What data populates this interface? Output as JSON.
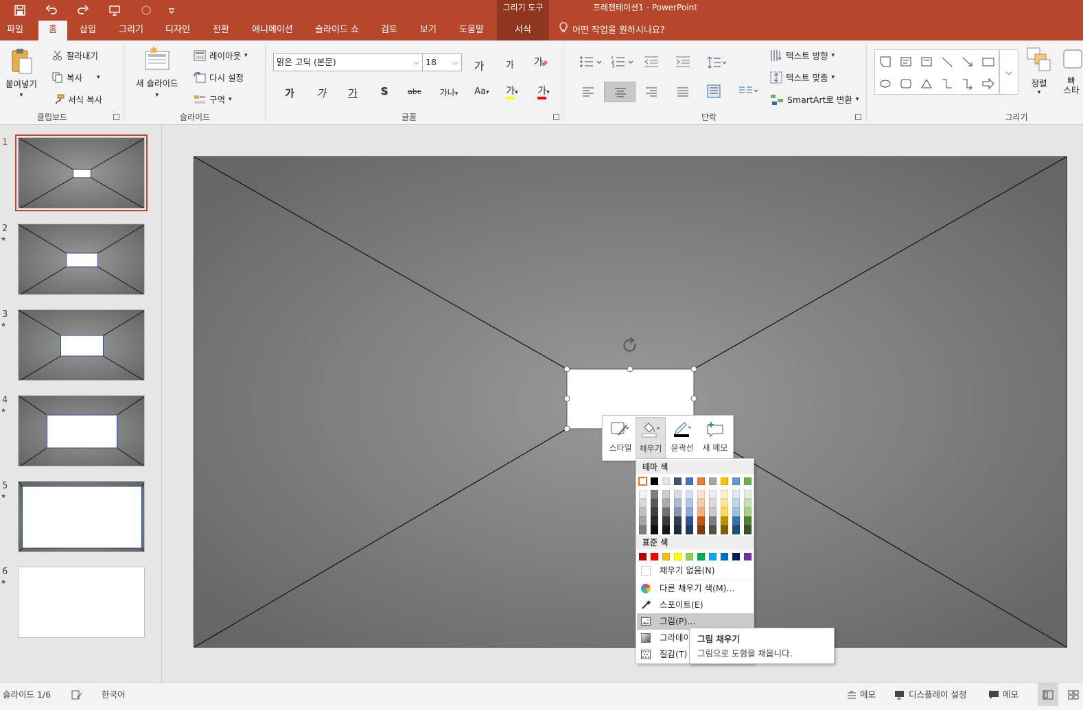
{
  "title_bar": {
    "context_tab_group": "그리기 도구",
    "document_title": "프레젠테이션1  -  PowerPoint"
  },
  "quick_access": [
    "save-icon",
    "undo-icon",
    "redo-icon",
    "present-icon",
    "touch-mode-icon",
    "customize-icon"
  ],
  "tabs": [
    "파일",
    "홈",
    "삽입",
    "그리기",
    "디자인",
    "전환",
    "애니메이션",
    "슬라이드 쇼",
    "검토",
    "보기",
    "도움말",
    "서식"
  ],
  "active_tab": "홈",
  "tell_me": "어떤 작업을 원하시나요?",
  "ribbon": {
    "clipboard": {
      "label": "클립보드",
      "paste": "붙여넣기",
      "cut": "잘라내기",
      "copy": "복사",
      "format_painter": "서식 복사"
    },
    "slides": {
      "label": "슬라이드",
      "new_slide": "새 슬라이드",
      "layout": "레이아웃",
      "reset": "다시 설정",
      "section": "구역"
    },
    "font": {
      "label": "글꼴",
      "font_name": "맑은 고딕 (본문)",
      "font_size": "18",
      "grow": "가",
      "shrink": "가",
      "bold": "가",
      "italic": "가",
      "underline": "가",
      "shadow": "S",
      "strike": "abc",
      "spacing": "가나",
      "case": "Aa",
      "highlight": "가",
      "color": "가"
    },
    "paragraph": {
      "label": "단락",
      "text_direction": "텍스트 방향",
      "align_text": "텍스트 맞춤",
      "smartart": "SmartArt로 변환"
    },
    "drawing": {
      "label": "그리기",
      "arrange": "정렬",
      "quick_styles_partial": "빠",
      "quick_styles_partial2": "스타"
    }
  },
  "slides_panel": {
    "slides": [
      {
        "number": "1",
        "star": "",
        "inner_rect": "small"
      },
      {
        "number": "2",
        "star": "★",
        "inner_rect": "medium-small"
      },
      {
        "number": "3",
        "star": "★",
        "inner_rect": "medium"
      },
      {
        "number": "4",
        "star": "★",
        "inner_rect": "large"
      },
      {
        "number": "5",
        "star": "★",
        "inner_rect": "xlarge"
      },
      {
        "number": "6",
        "star": "★",
        "inner_rect": "blank"
      }
    ],
    "selected": 1
  },
  "mini_toolbar": {
    "style": "스타일",
    "fill": "채우기",
    "outline": "윤곽선",
    "new_comment": "새 메모"
  },
  "fill_menu": {
    "theme_colors_header": "테마 색",
    "standard_colors_header": "표준 색",
    "theme_colors": [
      "#ffffff",
      "#000000",
      "#e7e6e6",
      "#44546a",
      "#4472c4",
      "#ed7d31",
      "#a5a5a5",
      "#ffc000",
      "#5b9bd5",
      "#70ad47"
    ],
    "theme_shades": [
      [
        "#f2f2f2",
        "#7f7f7f",
        "#d0cece",
        "#d6dce4",
        "#d9e2f3",
        "#fbe5d5",
        "#ededed",
        "#fff2cc",
        "#deebf6",
        "#e2efd9"
      ],
      [
        "#d8d8d8",
        "#595959",
        "#aeabab",
        "#adb9ca",
        "#b4c6e7",
        "#f7cbac",
        "#dbdbdb",
        "#fee599",
        "#bdd7ee",
        "#c5e0b3"
      ],
      [
        "#bfbfbf",
        "#3f3f3f",
        "#757070",
        "#8496b0",
        "#8eaadb",
        "#f4b183",
        "#c9c9c9",
        "#ffd965",
        "#9cc3e5",
        "#a8d08d"
      ],
      [
        "#a5a5a5",
        "#262626",
        "#3a3838",
        "#323f4f",
        "#2f5496",
        "#c55a11",
        "#7b7b7b",
        "#bf9000",
        "#2e75b5",
        "#538135"
      ],
      [
        "#7f7f7f",
        "#0c0c0c",
        "#171616",
        "#222a35",
        "#1f3864",
        "#833c0b",
        "#525252",
        "#7f6000",
        "#1f4e79",
        "#375623"
      ]
    ],
    "standard_colors": [
      "#c00000",
      "#ff0000",
      "#ffc000",
      "#ffff00",
      "#92d050",
      "#00b050",
      "#00b0f0",
      "#0070c0",
      "#002060",
      "#7030a0"
    ],
    "no_fill": "채우기 없음(N)",
    "more_colors": "다른 채우기 색(M)...",
    "eyedropper": "스포이트(E)",
    "picture": "그림(P)...",
    "gradient": "그라데이",
    "texture": "질감(T)"
  },
  "tooltip": {
    "title": "그림 채우기",
    "description": "그림으로 도형을 채웁니다."
  },
  "status_bar": {
    "slide_counter": "슬라이드 1/6",
    "language": "한국어",
    "notes": "메모",
    "display_settings": "디스플레이 설정",
    "comments": "메모"
  },
  "colors": {
    "accent": "#b7472a",
    "accent_dark": "#8f3520",
    "ribbon_bg": "#f3f3f3",
    "selection": "#c0462a"
  }
}
